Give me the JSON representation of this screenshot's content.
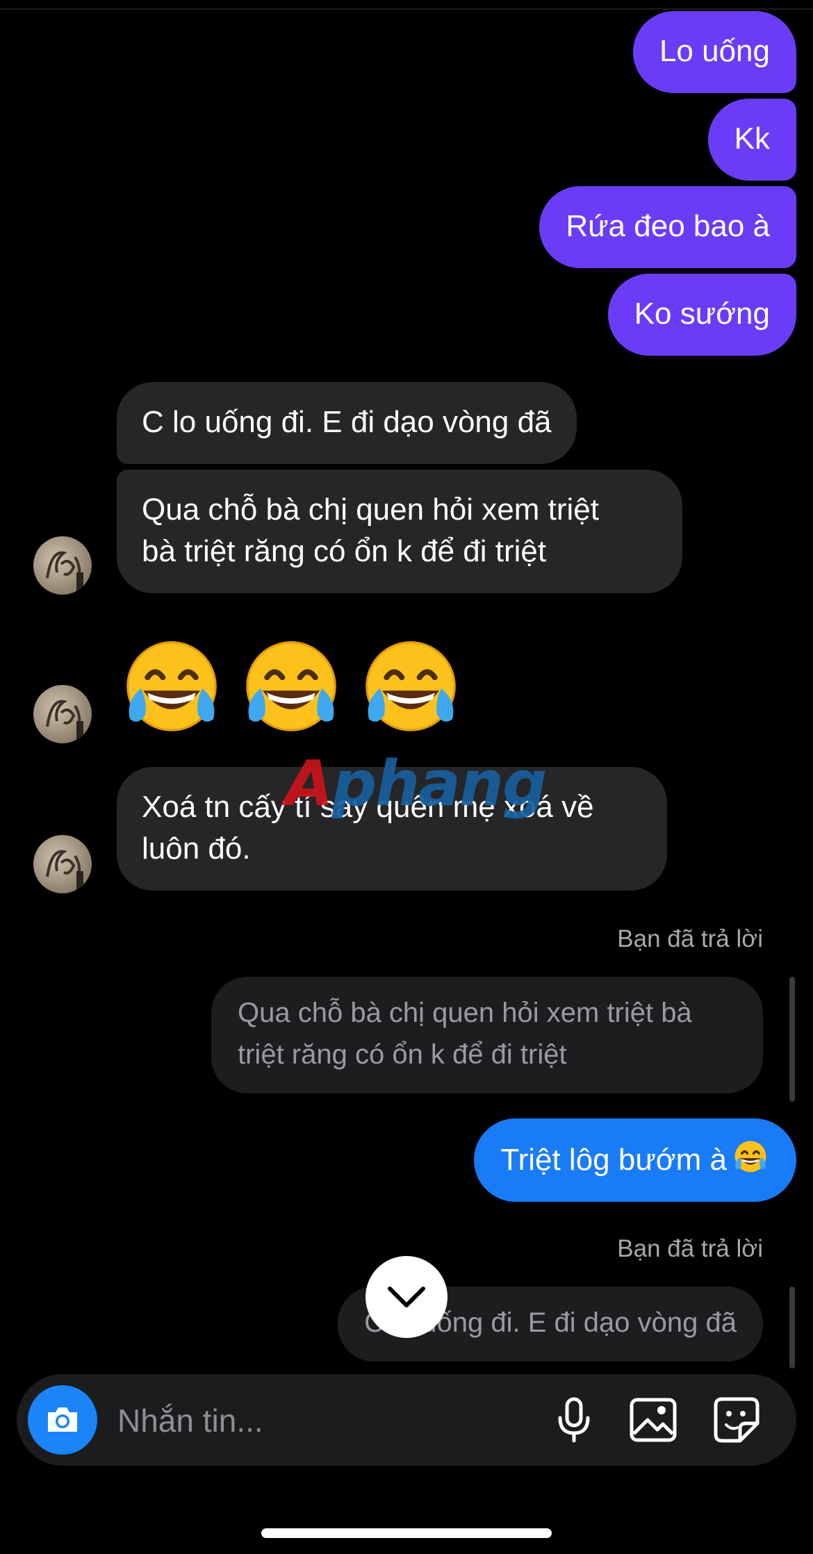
{
  "outgoing": [
    "Lo uống",
    "Kk",
    "Rứa đeo bao à",
    "Ko sướng"
  ],
  "incoming": {
    "m1": "C lo uống đi. E đi dạo vòng đã",
    "m2_line1": "Qua chỗ bà chị quen hỏi xem triệt",
    "m2_line2": "bà triệt răng có ổn k để đi triệt",
    "m4_line1": "Xoá tn cấy tí say quên mẹ xoá về",
    "m4_line2": "luôn đó."
  },
  "emoji_message": [
    "face-with-tears-of-joy",
    "face-with-tears-of-joy",
    "face-with-tears-of-joy"
  ],
  "watermark": {
    "part1": "A",
    "part2": "phang"
  },
  "reply1": {
    "label": "Bạn đã trả lời",
    "quote_line1": "Qua chỗ bà chị quen hỏi xem triệt bà",
    "quote_line2": "triệt răng có ổn k để đi triệt",
    "message": "Triệt lôg bướm à",
    "message_emoji": "face-with-tears-of-joy"
  },
  "reply2": {
    "label": "Bạn đã trả lời",
    "quote": "C lo uống đi. E đi dạo vòng đã"
  },
  "composer": {
    "placeholder": "Nhắn tin...",
    "icons": [
      "camera-icon",
      "microphone-icon",
      "gallery-icon",
      "sticker-icon"
    ]
  },
  "colors": {
    "outgoing_bubble": "#6b3cf7",
    "reply_bubble": "#1a7bf6",
    "incoming_bubble": "#262628",
    "camera_button": "#1a84f8"
  }
}
